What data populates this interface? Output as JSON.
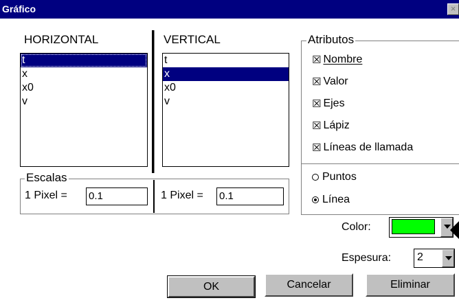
{
  "window": {
    "title": "Gráfico",
    "close_glyph": "×"
  },
  "horizontal": {
    "header": "HORIZONTAL",
    "items": [
      "t",
      "x",
      "x0",
      "v"
    ],
    "selected": "t"
  },
  "vertical": {
    "header": "VERTICAL",
    "items": [
      "t",
      "x",
      "x0",
      "v"
    ],
    "selected": "x"
  },
  "escalas": {
    "group_label": "Escalas",
    "h_label": "1 Pixel =",
    "h_value": "0.1",
    "v_label": "1 Pixel =",
    "v_value": "0.1"
  },
  "atributos": {
    "group_label": "Atributos",
    "checkboxes": [
      {
        "label": "Nombre",
        "checked": true
      },
      {
        "label": "Valor",
        "checked": true
      },
      {
        "label": "Ejes",
        "checked": true
      },
      {
        "label": "Lápiz",
        "checked": true
      },
      {
        "label": "Líneas de llamada",
        "checked": true
      }
    ],
    "radios": [
      {
        "label": "Puntos",
        "selected": false
      },
      {
        "label": "Línea",
        "selected": true
      }
    ],
    "check_glyph": "☒"
  },
  "color": {
    "label": "Color:",
    "value_color": "#00ff00",
    "icon": "dropdown-arrow-icon"
  },
  "espesura": {
    "label": "Espesura:",
    "value": "2"
  },
  "buttons": {
    "ok": "OK",
    "cancel": "Cancelar",
    "delete": "Eliminar"
  },
  "colors": {
    "title_bar": "#000080",
    "selection": "#000080",
    "button_face": "#c0c0c0"
  }
}
